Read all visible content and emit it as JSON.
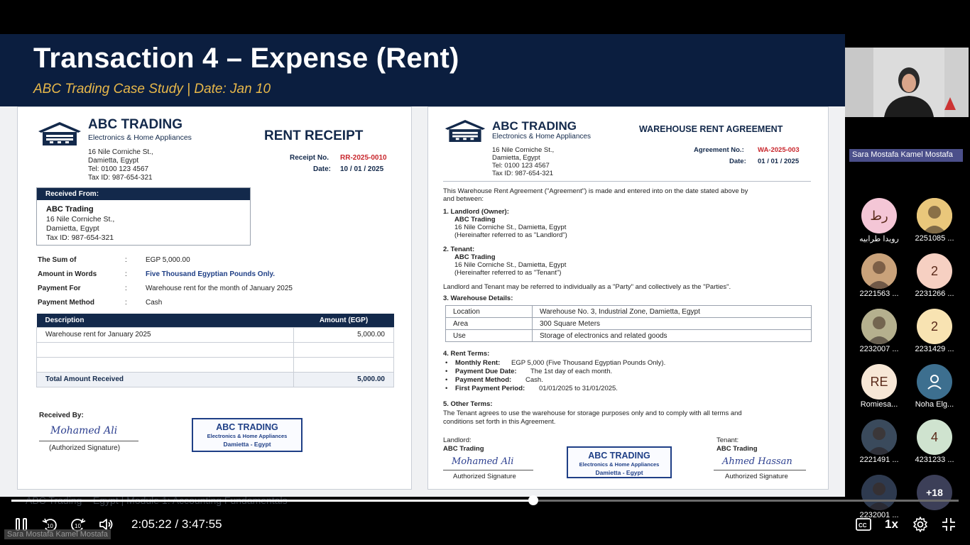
{
  "slide": {
    "title": "Transaction 4 – Expense (Rent)",
    "subtitle": "ABC Trading Case Study | Date: Jan 10",
    "footer": "ABC Trading – Egypt | Module 1: Accounting Fundamentals"
  },
  "company": {
    "name": "ABC TRADING",
    "tagline": "Electronics & Home Appliances",
    "address1": "16 Nile Corniche St.,",
    "address2": "Damietta, Egypt",
    "tel": "Tel: 0100 123 4567",
    "taxid": "Tax ID: 987-654-321"
  },
  "receipt": {
    "heading": "RENT RECEIPT",
    "receipt_no_label": "Receipt No.",
    "receipt_no": "RR-2025-0010",
    "date_label": "Date:",
    "date": "10 / 01 / 2025",
    "received_from_label": "Received From:",
    "from_name": "ABC Trading",
    "from_addr1": "16 Nile Corniche St.,",
    "from_addr2": "Damietta, Egypt",
    "from_tax": "Tax ID: 987-654-321",
    "fields": [
      {
        "label": "The Sum of",
        "colon": ":",
        "value": "EGP 5,000.00"
      },
      {
        "label": "Amount in Words",
        "colon": ":",
        "value": "Five Thousand Egyptian Pounds Only."
      },
      {
        "label": "Payment For",
        "colon": ":",
        "value": "Warehouse rent for the month of January 2025"
      },
      {
        "label": "Payment Method",
        "colon": ":",
        "value": "Cash"
      }
    ],
    "table": {
      "col_desc": "Description",
      "col_amount": "Amount (EGP)",
      "row_desc": "Warehouse rent for January 2025",
      "row_amount": "5,000.00",
      "total_label": "Total Amount Received",
      "total_amount": "5,000.00"
    },
    "received_by": "Received By:",
    "signature": "Mohamed Ali",
    "sig_caption": "(Authorized Signature)",
    "stamp": {
      "line1": "ABC TRADING",
      "line2": "Electronics & Home Appliances",
      "line3": "Damietta - Egypt"
    }
  },
  "agreement": {
    "heading": "WAREHOUSE RENT AGREEMENT",
    "no_label": "Agreement No.:",
    "no": "WA-2025-003",
    "date_label": "Date:",
    "date": "01 / 01 / 2025",
    "intro1": "This Warehouse Rent Agreement (\"Agreement\") is made and entered into on the date stated above by",
    "intro2": "and between:",
    "landlord_head": "1. Landlord (Owner):",
    "landlord_name": "ABC Trading",
    "landlord_addr": "16 Nile Corniche St., Damietta, Egypt",
    "landlord_ref": "(Hereinafter referred to as \"Landlord\")",
    "tenant_head": "2. Tenant:",
    "tenant_name": "ABC Trading",
    "tenant_addr": "16 Nile Corniche St., Damietta, Egypt",
    "tenant_ref": "(Hereinafter referred to as \"Tenant\")",
    "parties": "Landlord and Tenant may be referred to individually as a \"Party\" and collectively as the \"Parties\".",
    "details_head": "3. Warehouse Details:",
    "details": [
      {
        "k": "Location",
        "v": "Warehouse No. 3, Industrial Zone, Damietta, Egypt"
      },
      {
        "k": "Area",
        "v": "300 Square Meters"
      },
      {
        "k": "Use",
        "v": "Storage of electronics and related goods"
      }
    ],
    "terms_head": "4. Rent Terms:",
    "terms": [
      {
        "k": "Monthly Rent:",
        "v": "EGP 5,000 (Five Thousand Egyptian Pounds Only)."
      },
      {
        "k": "Payment Due Date:",
        "v": "The 1st day of each month."
      },
      {
        "k": "Payment Method:",
        "v": "Cash."
      },
      {
        "k": "First Payment Period:",
        "v": "01/01/2025 to 31/01/2025."
      }
    ],
    "other_head": "5. Other Terms:",
    "other1": "The Tenant agrees to use the warehouse for storage purposes only and to comply with all terms and",
    "other2": "conditions set forth in this Agreement.",
    "landlord_label": "Landlord:",
    "landlord_sign_name": "ABC Trading",
    "landlord_sig": "Mohamed Ali",
    "tenant_label": "Tenant:",
    "tenant_sign_name": "ABC Trading",
    "tenant_sig": "Ahmed Hassan",
    "sig_caption": "Authorized Signature",
    "stamp": {
      "line1": "ABC TRADING",
      "line2": "Electronics & Home Appliances",
      "line3": "Damietta - Egypt"
    }
  },
  "participants": {
    "presenter": "Sara Mostafa Kamel Mostafa",
    "tiles": [
      {
        "initials": "رط",
        "name": "رويدا طرابيه",
        "bg": "#f4c6d6",
        "kind": "initials"
      },
      {
        "initials": "",
        "name": "2251085 ...",
        "bg": "#e9c77b",
        "kind": "photo"
      },
      {
        "initials": "",
        "name": "2221563 ...",
        "bg": "#c9a27a",
        "kind": "photo"
      },
      {
        "initials": "2",
        "name": "2231266 ...",
        "bg": "#f6d0c2",
        "kind": "initials"
      },
      {
        "initials": "",
        "name": "2232007 ...",
        "bg": "#b5b08e",
        "kind": "photo"
      },
      {
        "initials": "2",
        "name": "2231429 ...",
        "bg": "#f8e3b2",
        "kind": "initials"
      },
      {
        "initials": "RE",
        "name": "Romiesa...",
        "bg": "#f7e7d6",
        "kind": "initials"
      },
      {
        "initials": "",
        "name": "Noha Elg...",
        "bg": "#3d6f8f",
        "kind": "person"
      },
      {
        "initials": "",
        "name": "2221491 ...",
        "bg": "#3a4a5c",
        "kind": "photo"
      },
      {
        "initials": "4",
        "name": "4231233 ...",
        "bg": "#cfe3cf",
        "kind": "initials"
      },
      {
        "initials": "",
        "name": "2232001 ...",
        "bg": "#2e3a4f",
        "kind": "photo"
      },
      {
        "initials": "+18",
        "name": "",
        "bg": "#3c3f58",
        "kind": "more"
      }
    ]
  },
  "player": {
    "current_time": "2:05:22",
    "separator": " / ",
    "total_time": "3:47:55",
    "progress": 0.551,
    "speed": "1x",
    "overlay_name": "Sara Mostafa Kamel Mostafa"
  }
}
